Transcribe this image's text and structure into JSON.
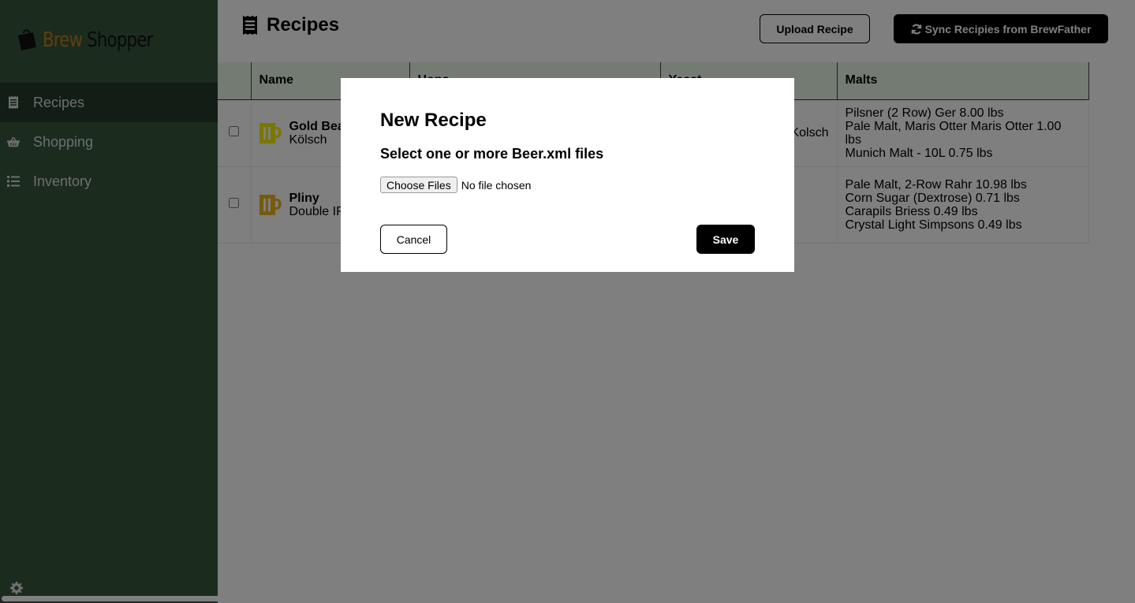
{
  "brand": {
    "word1": "Brew",
    "word2": " Shopper",
    "icon": "shopping-bag-icon"
  },
  "sidebar": {
    "items": [
      {
        "label": "Recipes",
        "icon": "receipt-icon",
        "active": true
      },
      {
        "label": "Shopping",
        "icon": "basket-icon",
        "active": false
      },
      {
        "label": "Inventory",
        "icon": "list-icon",
        "active": false
      }
    ],
    "settings_icon": "gear-icon"
  },
  "header": {
    "title": "Recipes",
    "title_icon": "receipt-icon",
    "upload_label": "Upload Recipe",
    "sync_label": "Sync Recipies from BrewFather",
    "sync_icon": "sync-icon"
  },
  "table": {
    "columns": [
      "",
      "Name",
      "Hops",
      "Yeast",
      "Malts"
    ],
    "rows": [
      {
        "name": "Gold Beach",
        "style": "Kölsch",
        "mug_color": "#f2ee00",
        "hops": "",
        "yeast": "Kolsch",
        "malts": [
          "Pilsner (2 Row) Ger 8.00 lbs",
          "Pale Malt, Maris Otter Maris Otter 1.00 lbs",
          "Munich Malt - 10L 0.75 lbs"
        ]
      },
      {
        "name": "Pliny",
        "style": "Double IPA",
        "mug_color": "#eab520",
        "hops": "",
        "yeast": "",
        "malts": [
          "Pale Malt, 2-Row Rahr 10.98 lbs",
          "Corn Sugar (Dextrose) 0.71 lbs",
          "Carapils Briess 0.49 lbs",
          "Crystal Light Simpsons 0.49 lbs"
        ]
      }
    ]
  },
  "modal": {
    "title": "New Recipe",
    "subtitle": "Select one or more Beer.xml files",
    "choose_files_label": "Choose Files",
    "file_status": "No file chosen",
    "cancel_label": "Cancel",
    "save_label": "Save"
  }
}
